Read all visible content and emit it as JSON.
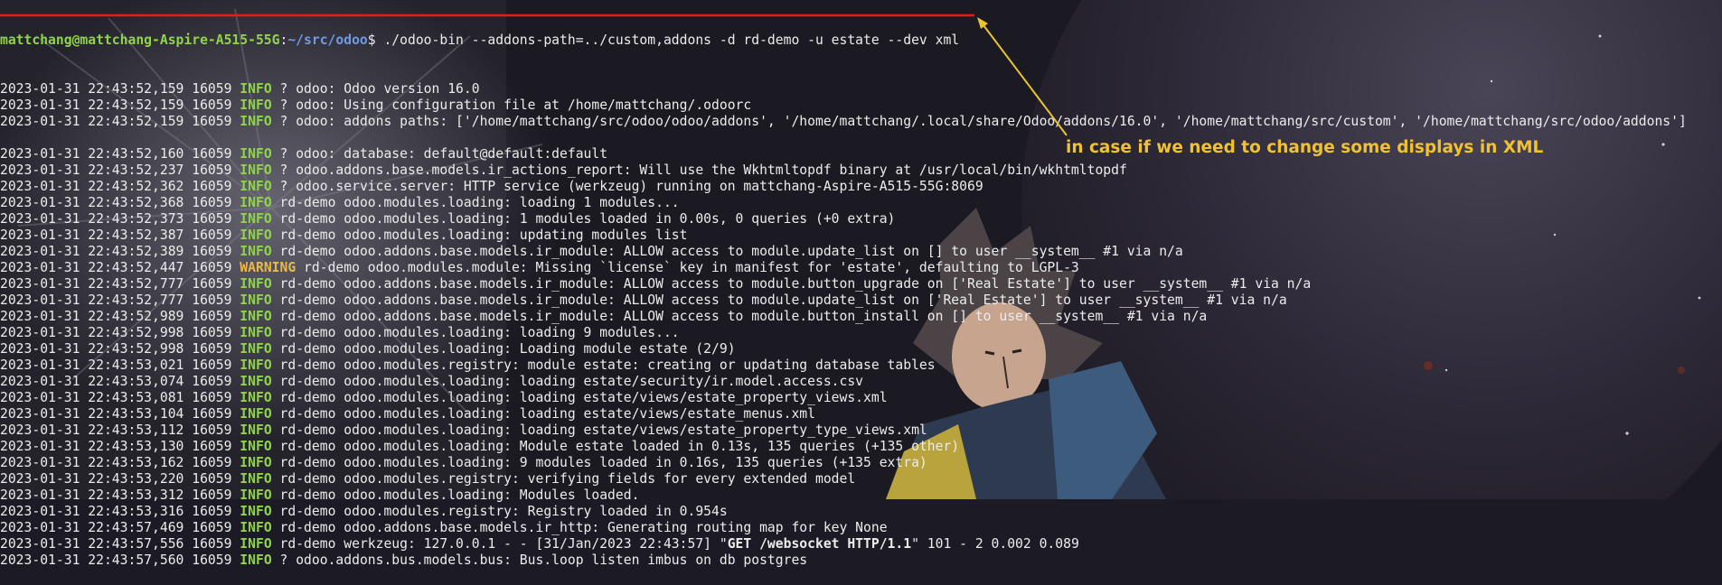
{
  "theme": {
    "prompt_user_color": "#8fd44a",
    "prompt_path_color": "#6d9be8",
    "info_color": "#8fd44a",
    "warning_color": "#e9b84a",
    "annotation_color": "#f2c12e",
    "underline_color": "#e02020",
    "arrow_color": "#e8c530"
  },
  "prompt": {
    "user_host": "mattchang@mattchang-Aspire-A515-55G",
    "separator": ":",
    "path": "~/src/odoo",
    "symbol": "$ ",
    "command": "./odoo-bin --addons-path=../custom,addons -d rd-demo -u estate --dev xml"
  },
  "annotation": {
    "text": "in case if we need to change some displays in XML"
  },
  "log_lines": [
    {
      "ts": "2023-01-31 22:43:52,159",
      "pid": "16059",
      "level": "INFO",
      "msg": " ? odoo: Odoo version 16.0"
    },
    {
      "ts": "2023-01-31 22:43:52,159",
      "pid": "16059",
      "level": "INFO",
      "msg": " ? odoo: Using configuration file at /home/mattchang/.odoorc"
    },
    {
      "ts": "2023-01-31 22:43:52,159",
      "pid": "16059",
      "level": "INFO",
      "msg": " ? odoo: addons paths: ['/home/mattchang/src/odoo/odoo/addons', '/home/mattchang/.local/share/Odoo/addons/16.0', '/home/mattchang/src/custom', '/home/mattchang/src/odoo/addons']"
    },
    {
      "blank": true
    },
    {
      "ts": "2023-01-31 22:43:52,160",
      "pid": "16059",
      "level": "INFO",
      "msg": " ? odoo: database: default@default:default"
    },
    {
      "ts": "2023-01-31 22:43:52,237",
      "pid": "16059",
      "level": "INFO",
      "msg": " ? odoo.addons.base.models.ir_actions_report: Will use the Wkhtmltopdf binary at /usr/local/bin/wkhtmltopdf"
    },
    {
      "ts": "2023-01-31 22:43:52,362",
      "pid": "16059",
      "level": "INFO",
      "msg": " ? odoo.service.server: HTTP service (werkzeug) running on mattchang-Aspire-A515-55G:8069"
    },
    {
      "ts": "2023-01-31 22:43:52,368",
      "pid": "16059",
      "level": "INFO",
      "msg": " rd-demo odoo.modules.loading: loading 1 modules..."
    },
    {
      "ts": "2023-01-31 22:43:52,373",
      "pid": "16059",
      "level": "INFO",
      "msg": " rd-demo odoo.modules.loading: 1 modules loaded in 0.00s, 0 queries (+0 extra)"
    },
    {
      "ts": "2023-01-31 22:43:52,387",
      "pid": "16059",
      "level": "INFO",
      "msg": " rd-demo odoo.modules.loading: updating modules list"
    },
    {
      "ts": "2023-01-31 22:43:52,389",
      "pid": "16059",
      "level": "INFO",
      "msg": " rd-demo odoo.addons.base.models.ir_module: ALLOW access to module.update_list on [] to user __system__ #1 via n/a"
    },
    {
      "ts": "2023-01-31 22:43:52,447",
      "pid": "16059",
      "level": "WARNING",
      "msg": " rd-demo odoo.modules.module: Missing `license` key in manifest for 'estate', defaulting to LGPL-3"
    },
    {
      "ts": "2023-01-31 22:43:52,777",
      "pid": "16059",
      "level": "INFO",
      "msg": " rd-demo odoo.addons.base.models.ir_module: ALLOW access to module.button_upgrade on ['Real Estate'] to user __system__ #1 via n/a"
    },
    {
      "ts": "2023-01-31 22:43:52,777",
      "pid": "16059",
      "level": "INFO",
      "msg": " rd-demo odoo.addons.base.models.ir_module: ALLOW access to module.update_list on ['Real Estate'] to user __system__ #1 via n/a"
    },
    {
      "ts": "2023-01-31 22:43:52,989",
      "pid": "16059",
      "level": "INFO",
      "msg": " rd-demo odoo.addons.base.models.ir_module: ALLOW access to module.button_install on [] to user __system__ #1 via n/a"
    },
    {
      "ts": "2023-01-31 22:43:52,998",
      "pid": "16059",
      "level": "INFO",
      "msg": " rd-demo odoo.modules.loading: loading 9 modules..."
    },
    {
      "ts": "2023-01-31 22:43:52,998",
      "pid": "16059",
      "level": "INFO",
      "msg": " rd-demo odoo.modules.loading: Loading module estate (2/9)"
    },
    {
      "ts": "2023-01-31 22:43:53,021",
      "pid": "16059",
      "level": "INFO",
      "msg": " rd-demo odoo.modules.registry: module estate: creating or updating database tables"
    },
    {
      "ts": "2023-01-31 22:43:53,074",
      "pid": "16059",
      "level": "INFO",
      "msg": " rd-demo odoo.modules.loading: loading estate/security/ir.model.access.csv"
    },
    {
      "ts": "2023-01-31 22:43:53,081",
      "pid": "16059",
      "level": "INFO",
      "msg": " rd-demo odoo.modules.loading: loading estate/views/estate_property_views.xml"
    },
    {
      "ts": "2023-01-31 22:43:53,104",
      "pid": "16059",
      "level": "INFO",
      "msg": " rd-demo odoo.modules.loading: loading estate/views/estate_menus.xml"
    },
    {
      "ts": "2023-01-31 22:43:53,112",
      "pid": "16059",
      "level": "INFO",
      "msg": " rd-demo odoo.modules.loading: loading estate/views/estate_property_type_views.xml"
    },
    {
      "ts": "2023-01-31 22:43:53,130",
      "pid": "16059",
      "level": "INFO",
      "msg": " rd-demo odoo.modules.loading: Module estate loaded in 0.13s, 135 queries (+135 other)"
    },
    {
      "ts": "2023-01-31 22:43:53,162",
      "pid": "16059",
      "level": "INFO",
      "msg": " rd-demo odoo.modules.loading: 9 modules loaded in 0.16s, 135 queries (+135 extra)"
    },
    {
      "ts": "2023-01-31 22:43:53,220",
      "pid": "16059",
      "level": "INFO",
      "msg": " rd-demo odoo.modules.registry: verifying fields for every extended model"
    },
    {
      "ts": "2023-01-31 22:43:53,312",
      "pid": "16059",
      "level": "INFO",
      "msg": " rd-demo odoo.modules.loading: Modules loaded."
    },
    {
      "ts": "2023-01-31 22:43:53,316",
      "pid": "16059",
      "level": "INFO",
      "msg": " rd-demo odoo.modules.registry: Registry loaded in 0.954s"
    },
    {
      "ts": "2023-01-31 22:43:57,469",
      "pid": "16059",
      "level": "INFO",
      "msg": " rd-demo odoo.addons.base.models.ir_http: Generating routing map for key None"
    },
    {
      "ts": "2023-01-31 22:43:57,556",
      "pid": "16059",
      "level": "INFO",
      "msg_before": " rd-demo werkzeug: 127.0.0.1 - - [31/Jan/2023 22:43:57] \"",
      "msg_bold": "GET /websocket HTTP/1.1",
      "msg_after": "\" 101 - 2 0.002 0.089"
    },
    {
      "ts": "2023-01-31 22:43:57,560",
      "pid": "16059",
      "level": "INFO",
      "msg": " ? odoo.addons.bus.models.bus: Bus.loop listen imbus on db postgres"
    }
  ]
}
